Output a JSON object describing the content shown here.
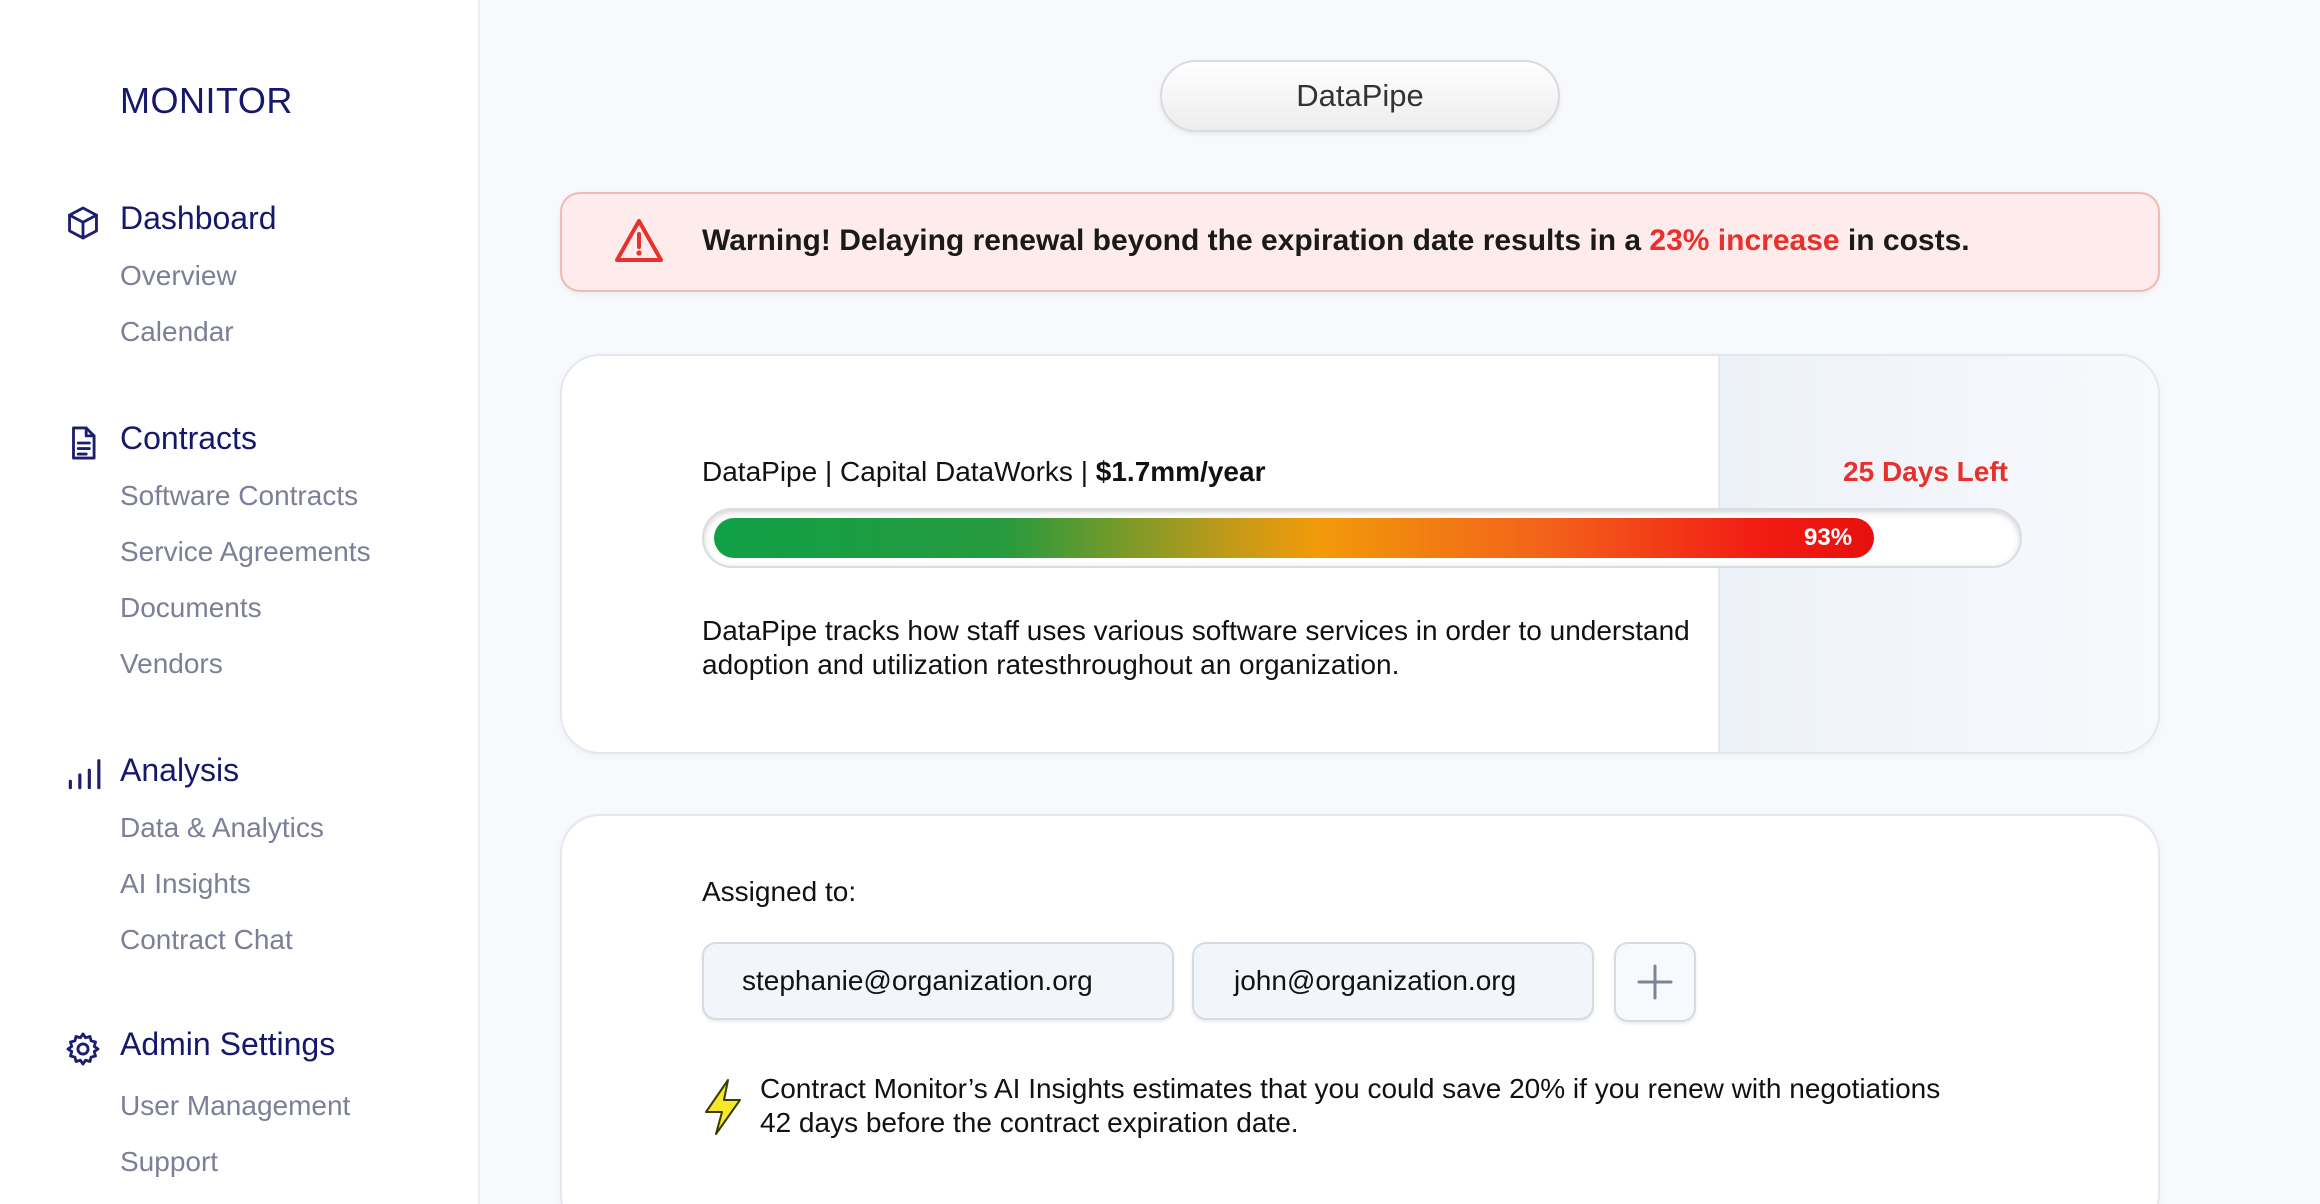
{
  "sidebar": {
    "brand": "MONITOR",
    "sections": [
      {
        "label": "Dashboard",
        "icon": "cube-icon",
        "items": [
          "Overview",
          "Calendar"
        ]
      },
      {
        "label": "Contracts",
        "icon": "document-icon",
        "items": [
          "Software Contracts",
          "Service Agreements",
          "Documents",
          "Vendors"
        ]
      },
      {
        "label": "Analysis",
        "icon": "bar-chart-icon",
        "items": [
          "Data & Analytics",
          "AI Insights",
          "Contract Chat"
        ]
      },
      {
        "label": "Admin Settings",
        "icon": "gear-icon",
        "items": [
          "User Management",
          "Support"
        ]
      }
    ]
  },
  "header": {
    "product_name": "DataPipe"
  },
  "warning": {
    "icon": "warning-triangle-icon",
    "text_before": "Warning! Delaying renewal beyond the expiration date results in a ",
    "highlight": "23% increase",
    "text_after": " in costs.",
    "highlight_color": "#e8302d"
  },
  "contract": {
    "name": "DataPipe",
    "vendor": "Capital DataWorks",
    "separator": " | ",
    "cost": "$1.7mm/year",
    "days_left": "25 Days Left",
    "progress_value": 93,
    "progress_label": "93%",
    "description": "DataPipe tracks how staff uses various software services in order to understand adoption and utilization ratesthroughout an organization."
  },
  "assignment": {
    "label": "Assigned to:",
    "assignees": [
      "stephanie@organization.org",
      "john@organization.org"
    ],
    "add_icon": "plus-icon",
    "insight_icon": "lightning-bolt-icon",
    "insight_text": "Contract Monitor’s AI Insights estimates that you could save 20% if you renew with negotiations 42 days before the contract expiration date."
  }
}
